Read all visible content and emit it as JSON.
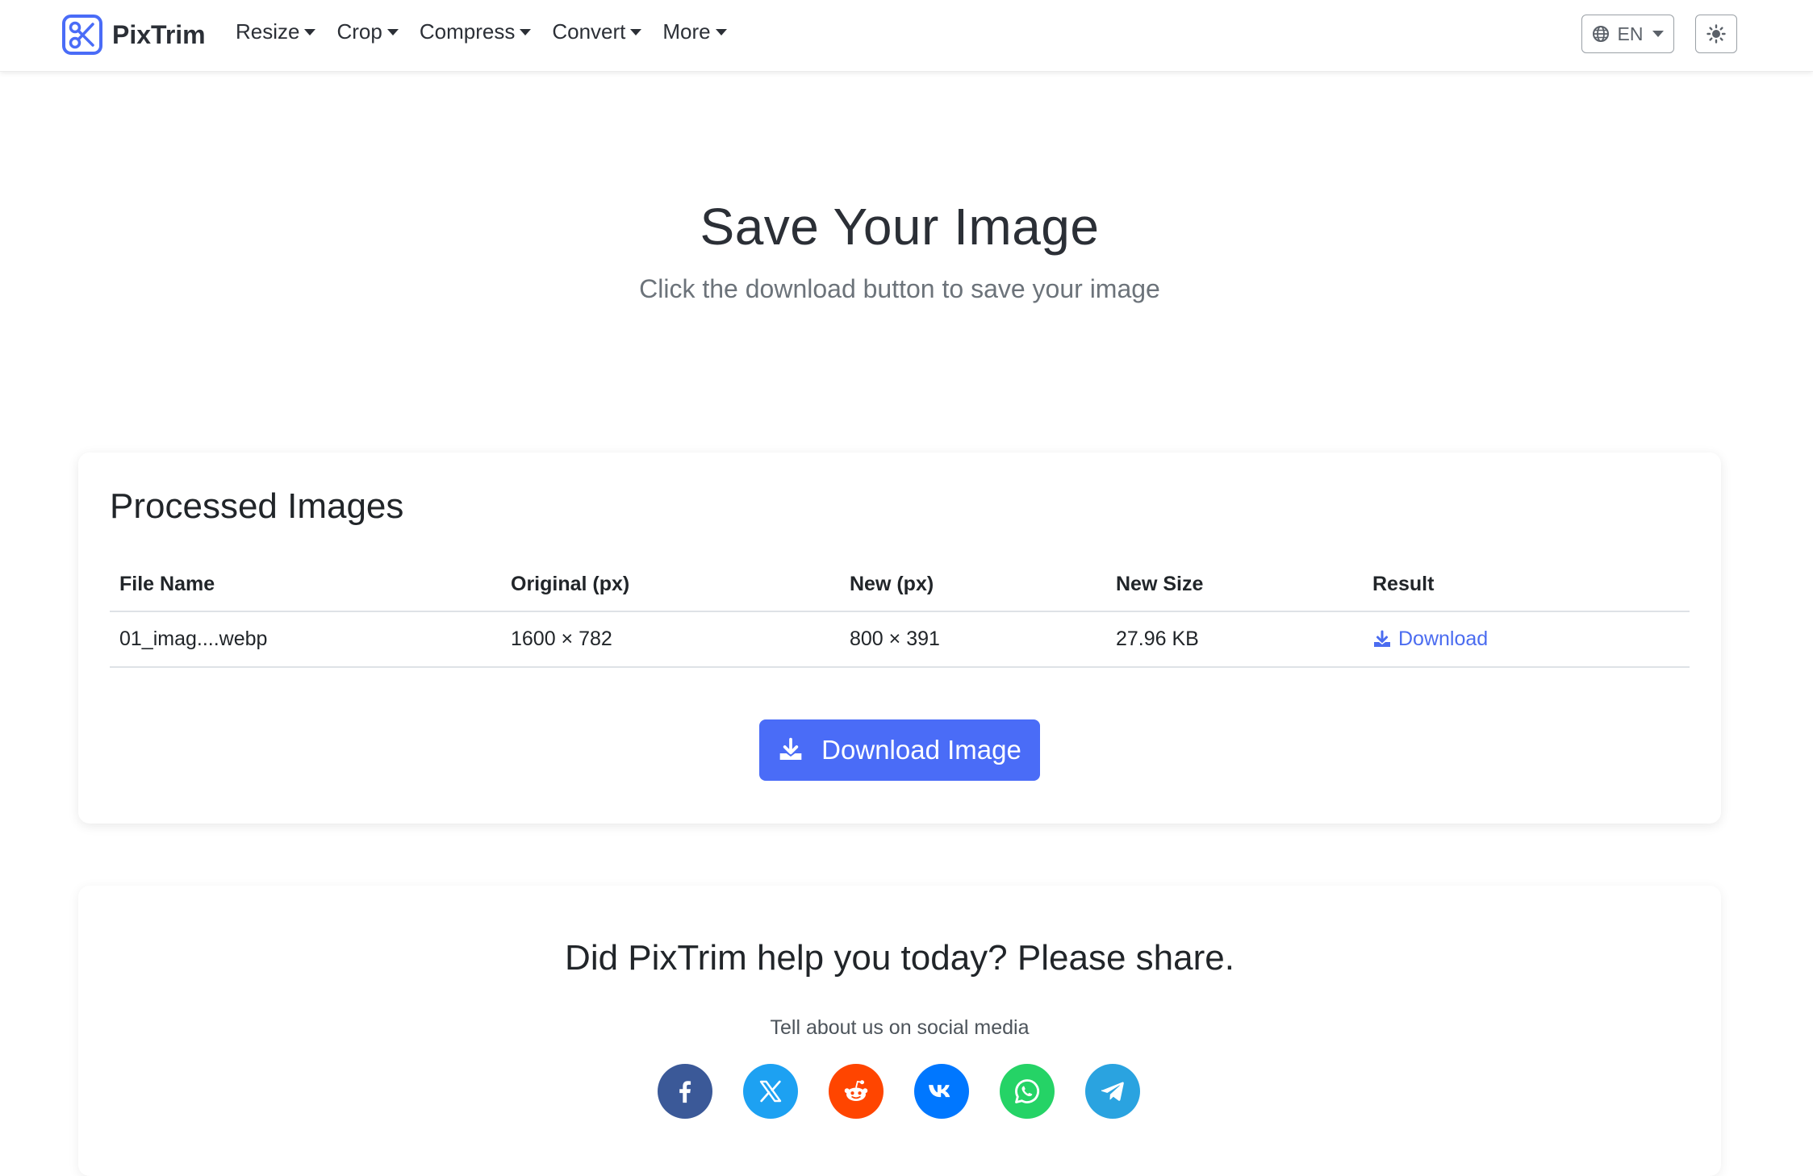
{
  "brand": {
    "name": "PixTrim"
  },
  "nav": {
    "items": [
      {
        "label": "Resize"
      },
      {
        "label": "Crop"
      },
      {
        "label": "Compress"
      },
      {
        "label": "Convert"
      },
      {
        "label": "More"
      }
    ],
    "language": "EN"
  },
  "hero": {
    "title": "Save Your Image",
    "subtitle": "Click the download button to save your image"
  },
  "processed": {
    "title": "Processed Images",
    "columns": [
      "File Name",
      "Original (px)",
      "New (px)",
      "New Size",
      "Result"
    ],
    "rows": [
      {
        "file": "01_imag....webp",
        "original": "1600 × 782",
        "new": "800 × 391",
        "size": "27.96 KB",
        "result": "Download"
      }
    ],
    "download_button": "Download Image"
  },
  "share": {
    "title": "Did PixTrim help you today? Please share.",
    "subtitle": "Tell about us on social media",
    "networks": [
      {
        "icon": "facebook-icon",
        "color": "#3b5998"
      },
      {
        "icon": "x-icon",
        "color": "#1da1f2"
      },
      {
        "icon": "reddit-icon",
        "color": "#ff4500"
      },
      {
        "icon": "vk-icon",
        "color": "#0077ff"
      },
      {
        "icon": "whatsapp-icon",
        "color": "#25d366"
      },
      {
        "icon": "telegram-icon",
        "color": "#2aa3e0"
      }
    ]
  },
  "colors": {
    "accent": "#4a6cf7",
    "link": "#4b6cf0"
  }
}
